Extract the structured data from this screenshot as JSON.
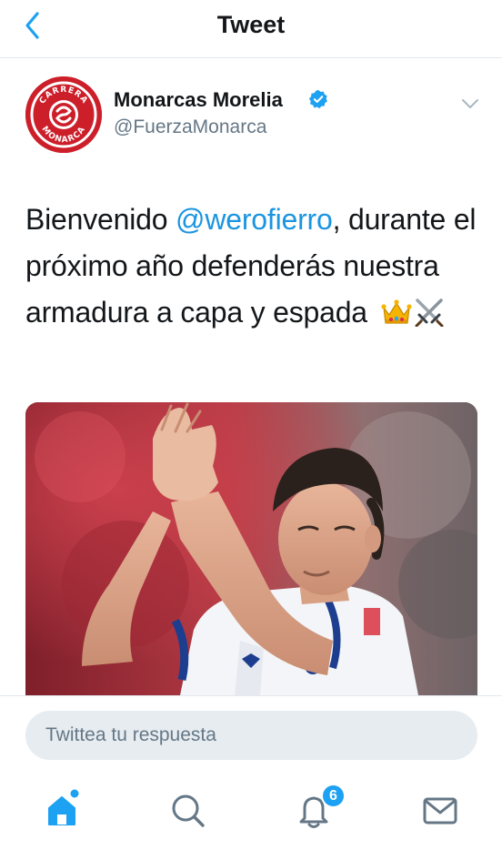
{
  "header": {
    "title": "Tweet",
    "back_icon": "chevron-left-icon"
  },
  "author": {
    "display_name": "Monarcas Morelia",
    "handle": "@FuerzaMonarca",
    "verified": true,
    "avatar_text_top": "CARRERA",
    "avatar_text_bottom": "MONARCA"
  },
  "tweet": {
    "text_before": "Bienvenido ",
    "mention": "@werofierro",
    "text_after": ", durante el próximo año defenderás nuestra armadura a capa y espada ",
    "emojis": [
      "crown-emoji",
      "crossed-swords-emoji"
    ]
  },
  "reply": {
    "placeholder": "Twittea tu respuesta"
  },
  "nav": {
    "items": [
      "home-icon",
      "search-icon",
      "notifications-icon",
      "messages-icon"
    ],
    "notifications_badge": "6"
  },
  "colors": {
    "accent": "#1da1f2",
    "mention": "#1b95e0",
    "secondary_text": "#657786",
    "brand_red": "#cc1f2a"
  }
}
